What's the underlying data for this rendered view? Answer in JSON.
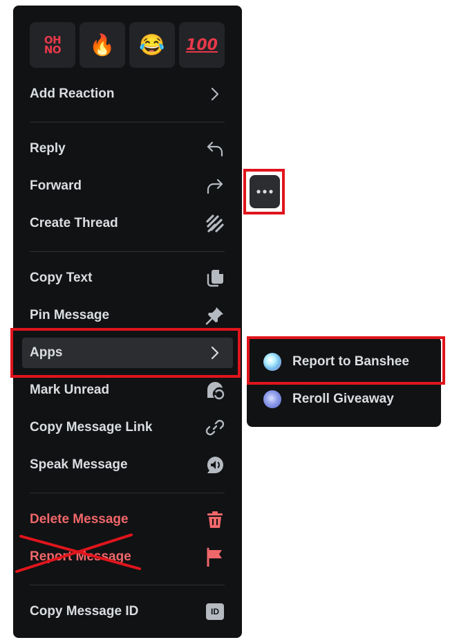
{
  "reactions": [
    {
      "name": "oh-no-emoji",
      "line1": "OH",
      "line2": "NO"
    },
    {
      "name": "fire-emoji",
      "glyph": "🔥"
    },
    {
      "name": "joy-emoji",
      "glyph": "😂"
    },
    {
      "name": "hundred-emoji",
      "text": "100"
    }
  ],
  "menu": {
    "add_reaction": "Add Reaction",
    "reply": "Reply",
    "forward": "Forward",
    "create_thread": "Create Thread",
    "copy_text": "Copy Text",
    "pin_message": "Pin Message",
    "apps": "Apps",
    "mark_unread": "Mark Unread",
    "copy_message_link": "Copy Message Link",
    "speak_message": "Speak Message",
    "delete_message": "Delete Message",
    "report_message": "Report Message",
    "copy_message_id": "Copy Message ID",
    "id_badge": "ID"
  },
  "submenu": {
    "report_to_banshee": "Report to Banshee",
    "reroll_giveaway": "Reroll Giveaway"
  },
  "colors": {
    "menu_bg": "#111214",
    "hover_bg": "#2b2d31",
    "danger": "#f0676a",
    "highlight": "#e0151c",
    "text": "#dbdee1"
  }
}
